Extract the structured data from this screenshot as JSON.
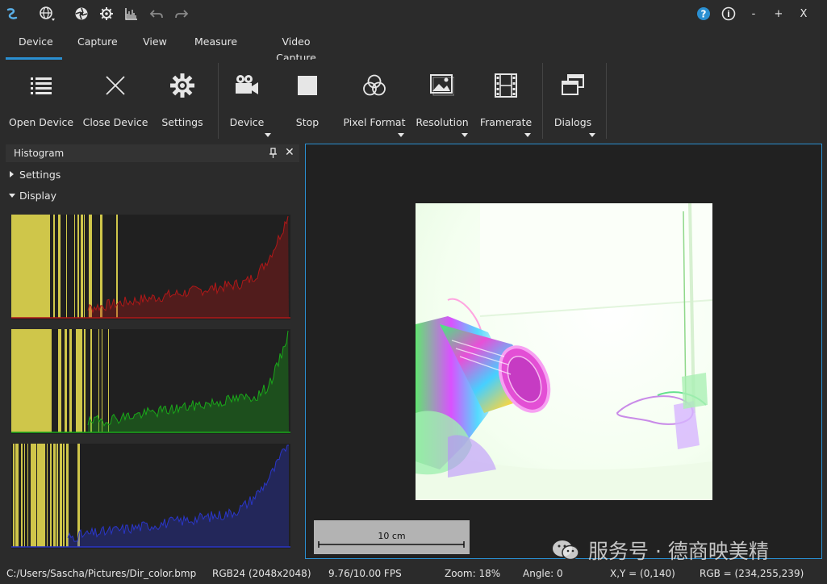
{
  "titlebar": {
    "app_icon": "app-logo-icon",
    "quick_icons": [
      "globe-icon",
      "aperture-icon",
      "gear-icon",
      "histogram-icon",
      "undo-icon",
      "redo-icon"
    ],
    "help_label": "?",
    "info_label": "i",
    "minimize_label": "-",
    "maximize_label": "+",
    "close_label": "X"
  },
  "menu": {
    "tabs": [
      {
        "label": "Device",
        "active": true
      },
      {
        "label": "Capture"
      },
      {
        "label": "View"
      },
      {
        "label": "Measure"
      },
      {
        "label": "Video Capture"
      }
    ]
  },
  "ribbon": {
    "buttons": [
      {
        "label": "Open Device",
        "icon": "list-icon"
      },
      {
        "label": "Close Device",
        "icon": "close-icon"
      },
      {
        "label": "Settings",
        "icon": "gear-icon"
      },
      {
        "label": "Device",
        "icon": "camera-icon",
        "dropdown": true
      },
      {
        "label": "Stop",
        "icon": "stop-icon"
      },
      {
        "label": "Pixel Format",
        "icon": "color-circles-icon",
        "dropdown": true
      },
      {
        "label": "Resolution",
        "icon": "image-icon",
        "dropdown": true
      },
      {
        "label": "Framerate",
        "icon": "film-icon",
        "dropdown": true
      },
      {
        "label": "Dialogs",
        "icon": "windows-icon",
        "dropdown": true
      }
    ]
  },
  "histogram_panel": {
    "title": "Histogram",
    "sections": [
      {
        "label": "Settings",
        "expanded": false
      },
      {
        "label": "Display",
        "expanded": true
      }
    ],
    "channels": [
      {
        "name": "red",
        "color": "#b01818"
      },
      {
        "name": "green",
        "color": "#1aa81a"
      },
      {
        "name": "blue",
        "color": "#2a36c8"
      }
    ],
    "highlight_color": "#cfc64a"
  },
  "viewer": {
    "accent_color": "#2a8fd1",
    "scale_bar_label": "10 cm"
  },
  "watermark": {
    "text": "服务号 · 德商映美精"
  },
  "status": {
    "path": "C:/Users/Sascha/Pictures/Dir_color.bmp",
    "format": "RGB24 (2048x2048)",
    "fps": "9.76/10.00 FPS",
    "zoom": "Zoom: 18%",
    "angle": "Angle: 0",
    "xy": "X,Y = (0,140)",
    "rgb": "RGB = (234,255,239)"
  }
}
